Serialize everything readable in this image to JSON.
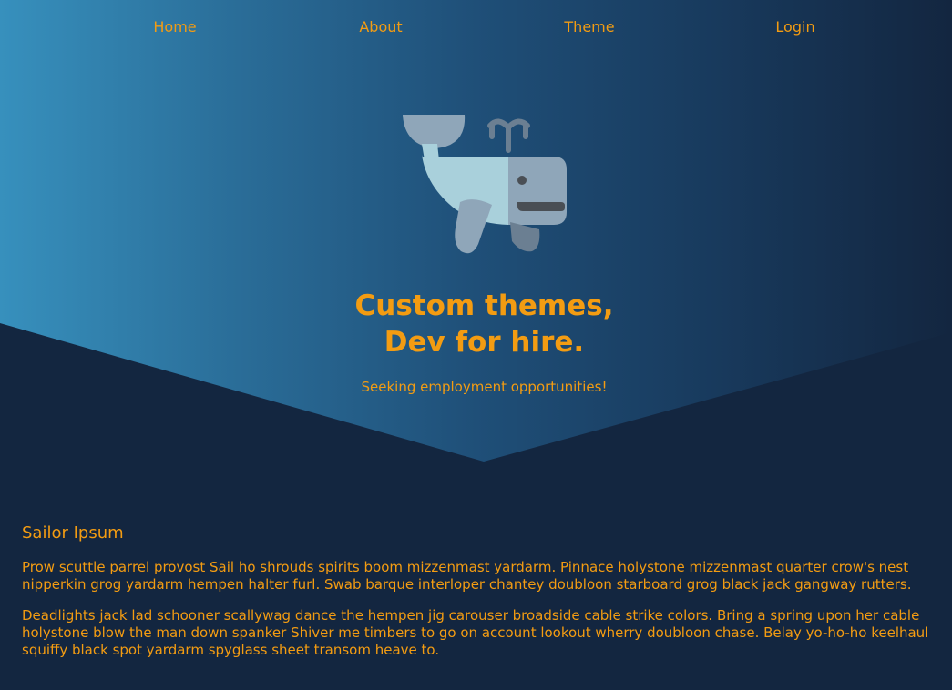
{
  "nav": {
    "items": [
      {
        "label": "Home"
      },
      {
        "label": "About"
      },
      {
        "label": "Theme"
      },
      {
        "label": "Login"
      }
    ]
  },
  "hero": {
    "logo_icon": "whale-icon",
    "headline_line1": "Custom themes,",
    "headline_line2": "Dev for hire.",
    "subtitle": "Seeking employment opportunities!"
  },
  "article": {
    "title": "Sailor Ipsum",
    "paragraphs": [
      "Prow scuttle parrel provost Sail ho shrouds spirits boom mizzenmast yardarm. Pinnace holystone mizzenmast quarter crow's nest nipperkin grog yardarm hempen halter furl. Swab barque interloper chantey doubloon starboard grog black jack gangway rutters.",
      "Deadlights jack lad schooner scallywag dance the hempen jig carouser broadside cable strike colors. Bring a spring upon her cable holystone blow the man down spanker Shiver me timbers to go on account lookout wherry doubloon chase. Belay yo-ho-ho keelhaul squiffy black spot yardarm spyglass sheet transom heave to."
    ]
  },
  "colors": {
    "accent": "#f39c12",
    "background": "#132640",
    "gradient_start": "#3790bd",
    "gradient_end": "#132640"
  }
}
